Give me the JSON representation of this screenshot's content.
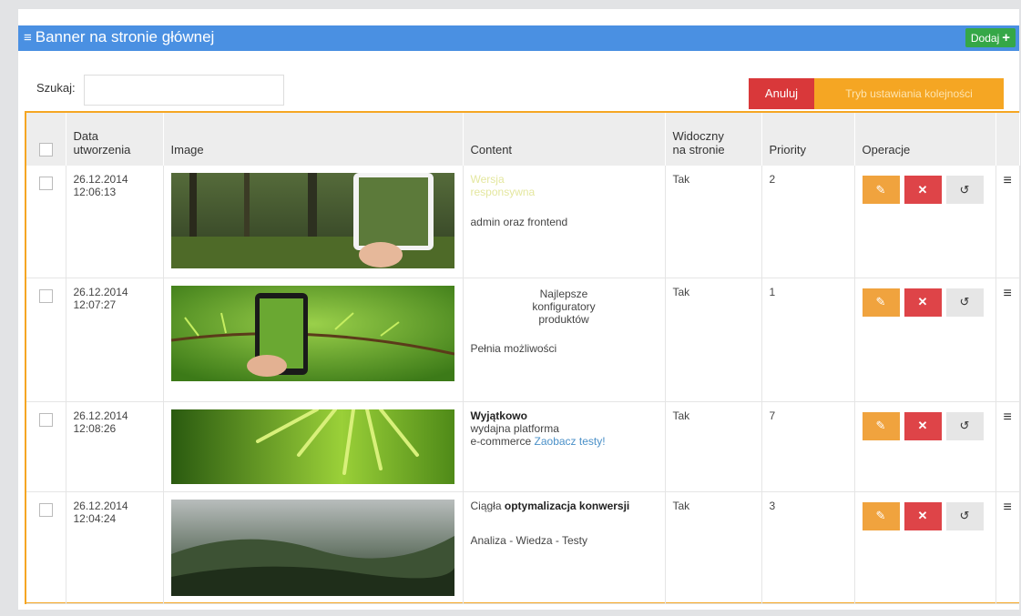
{
  "header": {
    "title": "Banner na stronie głównej",
    "add_label": "Dodaj"
  },
  "search": {
    "label": "Szukaj:",
    "value": ""
  },
  "buttons": {
    "cancel": "Anuluj",
    "order_mode": "Tryb ustawiania kolejności"
  },
  "columns": {
    "created": [
      "Data",
      "utworzenia"
    ],
    "image": "Image",
    "content": "Content",
    "visible": [
      "Widoczny",
      "na stronie"
    ],
    "priority": "Priority",
    "operations": "Operacje"
  },
  "rows": [
    {
      "date": "26.12.2014",
      "time": "12:06:13",
      "content_a": "Wersja",
      "content_b": "responsywna",
      "content_c": "admin oraz frontend",
      "visible": "Tak",
      "priority": "2"
    },
    {
      "date": "26.12.2014",
      "time": "12:07:27",
      "content_a": "Najlepsze",
      "content_b": "konfiguratory",
      "content_c": "produktów",
      "content_d": "Pełnia możliwości",
      "visible": "Tak",
      "priority": "1"
    },
    {
      "date": "26.12.2014",
      "time": "12:08:26",
      "content_a": "Wyjątkowo",
      "content_b": "wydajna platforma",
      "content_c": "e-commerce",
      "content_link": "Zaobacz testy!",
      "visible": "Tak",
      "priority": "7"
    },
    {
      "date": "26.12.2014",
      "time": "12:04:24",
      "content_a": "Ciągła",
      "content_b": "optymalizacja konwersji",
      "content_c": "Analiza - Wiedza - Testy",
      "visible": "Tak",
      "priority": "3"
    }
  ],
  "icons": {
    "edit": "pencil-icon",
    "delete": "close-icon",
    "history": "history-icon",
    "drag": "hamburger-icon"
  },
  "colors": {
    "header": "#4a90e2",
    "add": "#35a747",
    "cancel": "#d9383a",
    "order": "#f5a623",
    "edit": "#f0a33e",
    "delete": "#de4448"
  }
}
